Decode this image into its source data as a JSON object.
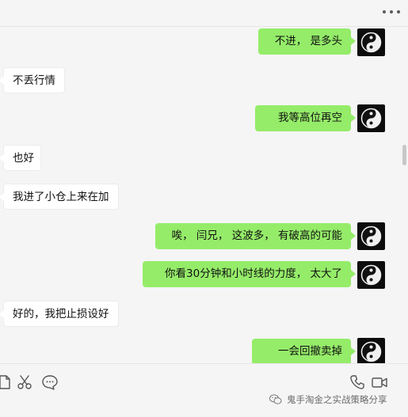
{
  "messages": [
    {
      "side": "out",
      "text": "不进， 是多头"
    },
    {
      "side": "in",
      "text": "不丢行情"
    },
    {
      "side": "out",
      "text": "我等高位再空"
    },
    {
      "side": "in",
      "text": "也好"
    },
    {
      "side": "in",
      "text": "我进了小仓上来在加"
    },
    {
      "side": "out",
      "text": "唉， 闫兄， 这波多， 有破高的可能"
    },
    {
      "side": "out",
      "text": "你看30分钟和小时线的力度，  太大了"
    },
    {
      "side": "in",
      "text": "好的，我把止损设好"
    },
    {
      "side": "out",
      "text": "一会回撤卖掉"
    }
  ],
  "toolbar": {
    "icons": [
      "file-icon",
      "scissors-icon",
      "chat-bubble-icon",
      "phone-icon",
      "video-icon"
    ]
  },
  "watermark": {
    "text": "鬼手淘金之实战策略分享",
    "icon": "wechat-icon"
  },
  "colors": {
    "background": "#f5f5f5",
    "outgoing_bubble": "#95ec69",
    "incoming_bubble": "#ffffff"
  }
}
